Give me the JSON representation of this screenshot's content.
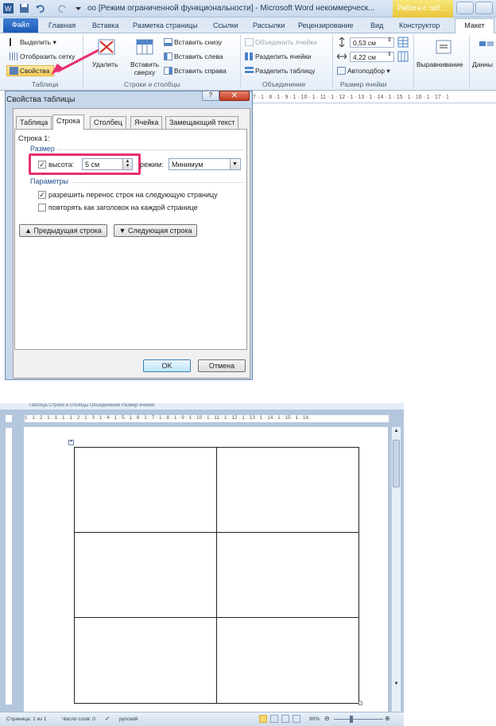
{
  "top": {
    "window_title": "оо [Режим ограниченной функциональности] - Microsoft Word некоммерческ...",
    "context_tab_title": "Работа с таб...",
    "tabs": [
      "Файл",
      "Главная",
      "Вставка",
      "Разметка страницы",
      "Ссылки",
      "Рассылки",
      "Рецензирование",
      "Вид",
      "Конструктор",
      "Макет"
    ],
    "ribbon": {
      "table_group": {
        "select": "Выделить",
        "show_grid": "Отобразить сетку",
        "properties": "Свойства",
        "label": "Таблица"
      },
      "rows_cols_group": {
        "delete": "Удалить",
        "insert_above": "Вставить сверху",
        "insert_below": "Вставить снизу",
        "insert_left": "Вставить слева",
        "insert_right": "Вставить справа",
        "label": "Строки и столбцы"
      },
      "merge_group": {
        "merge_cells": "Объединить ячейки",
        "split_cells": "Разделить ячейки",
        "split_table": "Разделить таблицу",
        "label": "Объединение"
      },
      "cell_size_group": {
        "height": "0,53 см",
        "width": "4,22 см",
        "autofit": "Автоподбор",
        "label": "Размер ячейки"
      },
      "align": "Выравнивание",
      "data": "Данны"
    },
    "ruler_text": "7 · 1 · 8 · 1 · 9 · 1 · 10 · 1 · 11 · 1 · 12 · 1 · 13 · 1 · 14 · 1 · 15 · 1 · 16 · 1 · 17 · 1"
  },
  "dialog": {
    "title": "Свойства таблицы",
    "help": "?",
    "close": "✕",
    "tabs": [
      "Таблица",
      "Строка",
      "Столбец",
      "Ячейка",
      "Замещающий текст"
    ],
    "row_label": "Строка 1:",
    "size_section": "Размер",
    "height_check": "✓",
    "height_label": "высота:",
    "height_value": "5 см",
    "mode_label": "режим:",
    "mode_value": "Минимум",
    "params_section": "Параметры",
    "allow_break_check": "✓",
    "allow_break": "разрешить перенос строк на следующую страницу",
    "repeat_header": "повторять как заголовок на каждой странице",
    "prev_row": "Предыдущая строка",
    "next_row": "Следующая строка",
    "ok": "OK",
    "cancel": "Отмена"
  },
  "bottom": {
    "ribbon_strip": "Таблица          Строки и столбцы          Объединение          Размер ячейки",
    "ruler_text": "1 · 1 · 2 · 1 · 1 · 1 · 1 · 2 · 1 · 3 · 1 · 4 · 1 · 5 · 1 · 6 · 1 · 7 · 1 · 8 · 1 · 9 · 1 · 10 · 1 · 11 · 1 · 12 · 1 · 13 · 1 · 14 · 1 · 15 · 1 · 16",
    "status": {
      "page": "Страница: 1 из 1",
      "words": "Число слов: 0",
      "lang": "русский",
      "zoom": "90%"
    }
  },
  "colors": {
    "accent_blue": "#1d5bb8",
    "highlight_pink": "#e8306f",
    "arrow_red": "#e8306f"
  }
}
